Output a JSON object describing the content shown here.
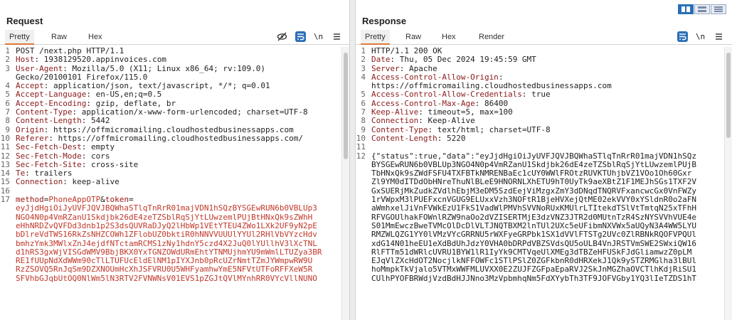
{
  "layout_buttons": [
    "side-by-side",
    "horizontal",
    "vertical"
  ],
  "request": {
    "title": "Request",
    "tabs": [
      "Pretty",
      "Raw",
      "Hex"
    ],
    "lines": [
      {
        "n": "1",
        "t": "POST /next.php HTTP/1.1"
      },
      {
        "n": "2",
        "k": "Host",
        "v": " 1938129520.appinvoices.com"
      },
      {
        "n": "3",
        "k": "User-Agent",
        "v": " Mozilla/5.0 (X11; Linux x86_64; rv:109.0)"
      },
      {
        "n": "",
        "t": "Gecko/20100101 Firefox/115.0"
      },
      {
        "n": "4",
        "k": "Accept",
        "v": " application/json, text/javascript, */*; q=0.01"
      },
      {
        "n": "5",
        "k": "Accept-Language",
        "v": " en-US,en;q=0.5"
      },
      {
        "n": "6",
        "k": "Accept-Encoding",
        "v": " gzip, deflate, br"
      },
      {
        "n": "7",
        "k": "Content-Type",
        "v": " application/x-www-form-urlencoded; charset=UTF-8"
      },
      {
        "n": "8",
        "k": "Content-Length",
        "v": " 5442"
      },
      {
        "n": "9",
        "k": "Origin",
        "v": " https://offmicromailing.cloudhostedbusinessapps.com"
      },
      {
        "n": "10",
        "k": "Referer",
        "v": " https://offmicromailing.cloudhostedbusinessapps.com/"
      },
      {
        "n": "11",
        "k": "Sec-Fetch-Dest",
        "v": " empty"
      },
      {
        "n": "12",
        "k": "Sec-Fetch-Mode",
        "v": " cors"
      },
      {
        "n": "13",
        "k": "Sec-Fetch-Site",
        "v": " cross-site"
      },
      {
        "n": "14",
        "k": "Te",
        "v": " trailers"
      },
      {
        "n": "15",
        "k": "Connection",
        "v": " keep-alive"
      },
      {
        "n": "16",
        "t": ""
      },
      {
        "n": "17",
        "p1k": "method",
        "p1v": "PhoneAppOTP",
        "p2k": "token"
      },
      {
        "n": "",
        "b": "eyJjdHgiOiJyUVFJQVJBQWhaSTlqTnRrR01majVDN1hSQzBYSGEwRUN6b0VBLUp3"
      },
      {
        "n": "",
        "b": "NGO4N0p4VmRZanU1Skdjbk26dE4zeTZSblRqSjYtLUwzemlPUjBtHNxQk9sZWhH"
      },
      {
        "n": "",
        "b": "eHhNRDZvQVFDd3dnb1p2S3dsQUVRaDJyQ2lHbWp1VEtYTEU4ZWo1LXk2UF9yN2pE"
      },
      {
        "n": "",
        "b": "bDlreVdTWS16RkZsNHZCOWh1ZFlobUZ0bktiR0hNNVVUUUlYYUl2RHlVbVYzcHdv"
      },
      {
        "n": "",
        "b": "bmhzYmk3MWlxZnJ4ejdfNTctamRCMS1zNy1hdnY5czd4X2JuQ0lYUllhV3lXcTNL"
      },
      {
        "n": "",
        "b": "d1hRS3gxWjVISGdWMV9BbjBKX0YxTGNZOWdURmEhtYTNMUjhmYU9mWmlLTUZya3BR"
      },
      {
        "n": "",
        "b": "RE1fUUpNdXdWWm90cTlLTUFUcEldElNM1pIYXJnb0pRcUZrNmtTZmJYWmpwRW9U"
      },
      {
        "n": "",
        "b": "RzZSOVQ5RnJqSm9DZXNOUmHcXhJSFVRU0U5WHFyamhwYmE5NFVtUTFoRFFXeW5R"
      },
      {
        "n": "",
        "b": "SFVhbGJqbUtOQ0NlWm5lN3RTV2FVNWNsV01EVS1pZGJtQVlMYnhRR0VYcVllNUNO"
      }
    ]
  },
  "response": {
    "title": "Response",
    "tabs": [
      "Pretty",
      "Raw",
      "Hex",
      "Render"
    ],
    "lines": [
      {
        "n": "1",
        "t": "HTTP/1.1 200 OK"
      },
      {
        "n": "2",
        "k": "Date",
        "v": " Thu, 05 Dec 2024 19:45:59 GMT"
      },
      {
        "n": "3",
        "k": "Server",
        "v": " Apache"
      },
      {
        "n": "4",
        "k": "Access-Control-Allow-Origin",
        "v": ""
      },
      {
        "n": "",
        "t": "https://offmicromailing.cloudhostedbusinessapps.com"
      },
      {
        "n": "5",
        "k": "Access-Control-Allow-Credentials",
        "v": " true"
      },
      {
        "n": "6",
        "k": "Access-Control-Max-Age",
        "v": " 86400"
      },
      {
        "n": "7",
        "k": "Keep-Alive",
        "v": " timeout=5, max=100"
      },
      {
        "n": "8",
        "k": "Connection",
        "v": " Keep-Alive"
      },
      {
        "n": "9",
        "k": "Content-Type",
        "v": " text/html; charset=UTF-8"
      },
      {
        "n": "10",
        "k": "Content-Length",
        "v": " 5220"
      },
      {
        "n": "11",
        "t": ""
      },
      {
        "n": "12",
        "t": "{\"status\":true,\"data\":\"eyJjdHgiOiJyUVFJQVJBQWhaSTlqTnRrR01majVDN1hSQz"
      },
      {
        "n": "",
        "t": "BYSGEwRUN6b0VBLUp3NGO4N0p4VmRZanU1Skdjbk26dE4zeTZSblRqSjYtLUwzemlPUjB"
      },
      {
        "n": "",
        "t": "TbHNxQk9sZWdFSFU4TXFBTkNMRENBaEc1cUY0WWlFROtzRUVKTUhjbVZ1VOo1Oh60Gxr"
      },
      {
        "n": "",
        "t": "Zl9YM0dITDdObHNreThuNlBLeE9HNORNLXhETU9hT0UyTk9aeXBtZ1F1MEJhSGs1TXF2V"
      },
      {
        "n": "",
        "t": "GxSUERjMkZudkZVdlhEbjM3eDM5SzdEejViMzgxZmY3dDNqdTNQRVFxancwcGx0VnFWZy"
      },
      {
        "n": "",
        "t": "1rVWpxM3lPUEFxcnVGUG9ELUxxVzh3NOFtR1BjeHVXejQtME02ekVVY0xYSldnR0o2aFN"
      },
      {
        "n": "",
        "t": "aWmhxelJiVnFVWkEzU1FkS1VadWlPMVhSVVNoRUxKMUlrLTItekdTSlVtTmtqN25xTFhH"
      },
      {
        "n": "",
        "t": "RFVGOUlhakFOWnlRZW9naOo2dVZISERTMjE3dzVNZ3JTR2d0MUtnTzR4SzNYSVVhVUE4e"
      },
      {
        "n": "",
        "t": "S01MmEwczBweTVMcOlDcDlVLTJNQTBXM2lnTUl2UXc5eUFibmNXVWx5aUQyN3A4WW5LYU"
      },
      {
        "n": "",
        "t": "RMZWLQZG1YY0lVMzVYcGRRNU5rWXFyeGRPbk1SX1dVVlFTSTg2UVc0ZlRBNkRQOFVPQUl"
      },
      {
        "n": "",
        "t": "xdG14N01heEU1eXdBdUhJdzY0VHA0bDRPdVBZSVdsQU5oULB4VnJRSTVmSWE2SWxiQW16"
      },
      {
        "n": "",
        "t": "RlFTTm51dWRlcUVRU1BYW1lR1IyYk9CMTVqeUlXMEg3dTBZeHFUSkFJdGliamwzZ0pLM"
      },
      {
        "n": "",
        "t": "EJqVlZXcHdOT2NocjlkNFFOWFc1STlPSlZ0ZGFkbnR0dHRXekJ1Qk9ySTZRMGlha3lBUl"
      },
      {
        "n": "",
        "t": "hoMmpkTkVjalo5VTMxWWFMLUVXX0E2ZUJFZGFpaEpaRVJ2SkJnMGZhaOVCTlhKdjRiSU1"
      },
      {
        "n": "",
        "t": "CUlhPYOFBRWdjVzdBdHJJNno3MzVpbmhqNm5FdXYybTh3TF9JOFVGby1YQ3lIeTZDS1hT"
      }
    ]
  }
}
